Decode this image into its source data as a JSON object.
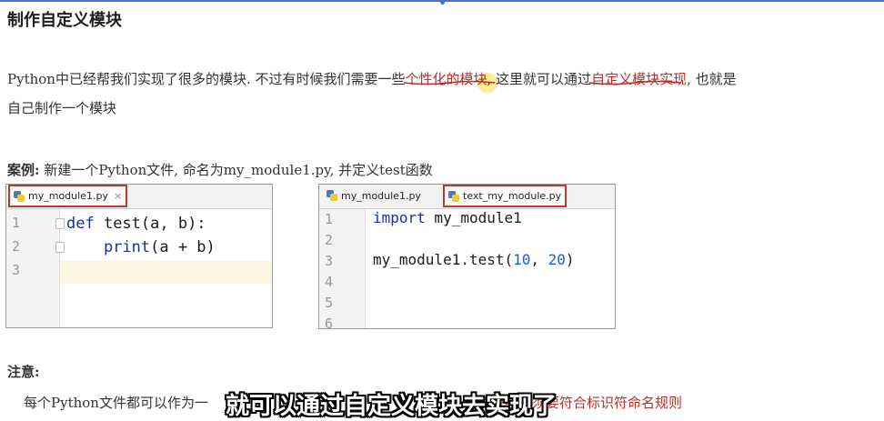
{
  "page": {
    "title": "制作自定义模块",
    "paragraph": {
      "part1": "Python中已经帮我们实现了很多的模块. 不过有时候我们需要一些",
      "highlight1": "个性化的模块",
      "part2": ", 这里就可以通过",
      "highlight2": "自定义模块实现",
      "part3": ", 也就是",
      "line2": "自己制作一个模块"
    },
    "case_label": "案例:",
    "case_text": "新建一个Python文件, 命名为my_module1.py, 并定义test函数",
    "note_label": "注意:",
    "bottom_text_start": "每个Python文件都可以作为一",
    "bottom_text_end": "模块名必须要符合标识符命名规则"
  },
  "editor1": {
    "tab_label": "my_module1.py",
    "close_glyph": "×",
    "line_numbers": [
      "1",
      "2",
      "3"
    ],
    "lines": [
      {
        "kw": "def",
        "rest": " test(a, b):"
      },
      {
        "kw": "    print",
        "rest": "(a + b)"
      }
    ]
  },
  "editor2": {
    "tabs": [
      "my_module1.py",
      "text_my_module.py"
    ],
    "line_numbers": [
      "1",
      "2",
      "3",
      "4",
      "5",
      "6"
    ],
    "line1": {
      "kw": "import",
      "rest": " my_module1"
    },
    "line3": {
      "pre": "my_module1.test(",
      "n1": "10",
      "sep": ", ",
      "n2": "20",
      "post": ")"
    }
  },
  "subtitle": "就可以通过自定义模块去实现了",
  "colors": {
    "accent_red": "#c0392b",
    "keyword_blue": "#1c2fa6",
    "number_blue": "#1c5cd0",
    "highlight_text": "#b5302c"
  },
  "icons": [
    "python-file-icon",
    "close-icon"
  ]
}
